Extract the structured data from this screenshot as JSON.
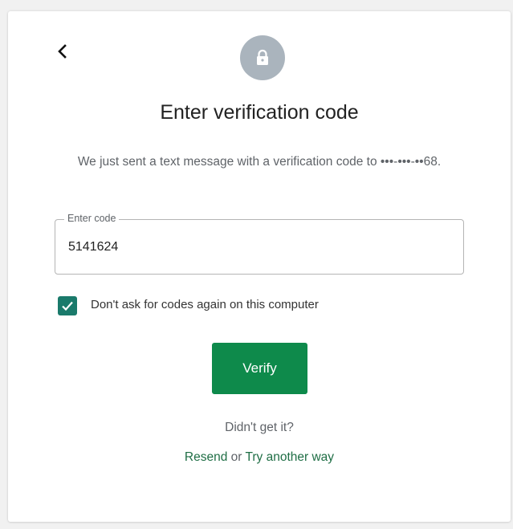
{
  "card": {
    "title": "Enter verification code",
    "subtitle": "We just sent a text message with a verification code to •••-•••-••68."
  },
  "code_field": {
    "label": "Enter code",
    "value": "5141624"
  },
  "remember": {
    "checked": true,
    "label": "Don't ask for codes again on this computer"
  },
  "verify_label": "Verify",
  "help": {
    "prompt": "Didn't get it?",
    "resend_label": "Resend",
    "or_text": "or",
    "try_another_label": "Try another way"
  },
  "icons": {
    "back": "chevron-left-icon",
    "lock": "lock-icon",
    "check": "checkmark-icon"
  },
  "colors": {
    "primary_button": "#0e8a4b",
    "checkbox": "#1a7a6b",
    "link": "#1f6e45",
    "lock_circle": "#aab4bd"
  }
}
